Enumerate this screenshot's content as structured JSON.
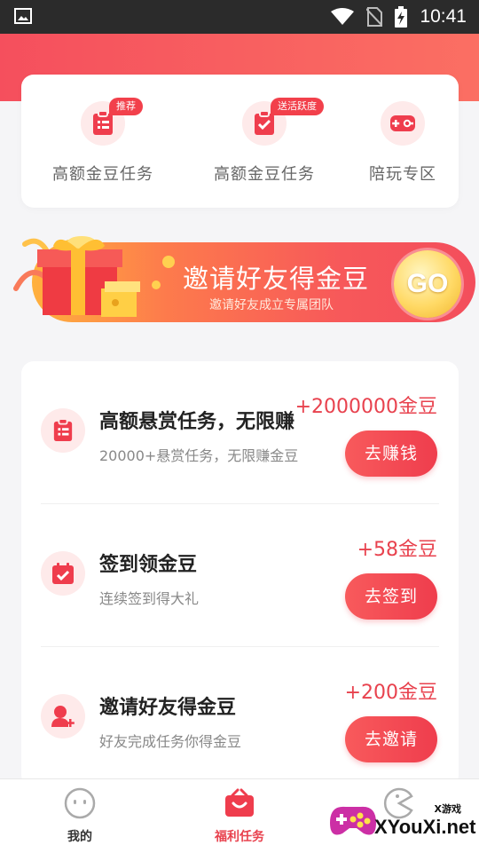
{
  "status_bar": {
    "time": "10:41"
  },
  "quick_actions": [
    {
      "label": "高额金豆任务",
      "badge": "推荐",
      "icon": "clipboard-list-icon"
    },
    {
      "label": "高额金豆任务",
      "badge": "送活跃度",
      "icon": "clipboard-check-icon"
    },
    {
      "label": "陪玩专区",
      "badge": "",
      "icon": "gamepad-icon"
    }
  ],
  "invite_banner": {
    "title": "邀请好友得金豆",
    "subtitle": "邀请好友成立专属团队",
    "go_label": "GO"
  },
  "tasks": [
    {
      "title": "高额悬赏任务，无限赚",
      "desc": "20000+悬赏任务，无限赚金豆",
      "reward": "+2000000金豆",
      "button": "去赚钱",
      "icon": "clipboard-list-icon"
    },
    {
      "title": "签到领金豆",
      "desc": "连续签到得大礼",
      "reward": "+58金豆",
      "button": "去签到",
      "icon": "calendar-check-icon"
    },
    {
      "title": "邀请好友得金豆",
      "desc": "好友完成任务你得金豆",
      "reward": "+200金豆",
      "button": "去邀请",
      "icon": "add-user-icon"
    }
  ],
  "bottom_nav": [
    {
      "label": "我的",
      "icon": "face-icon",
      "active": false
    },
    {
      "label": "福利任务",
      "icon": "basket-icon",
      "active": true
    }
  ],
  "watermark": {
    "small": "X游戏",
    "text": "XYouXi.net"
  },
  "colors": {
    "accent": "#ef3d4d",
    "reward": "#e8424e",
    "icon_bg": "#feeaea"
  }
}
